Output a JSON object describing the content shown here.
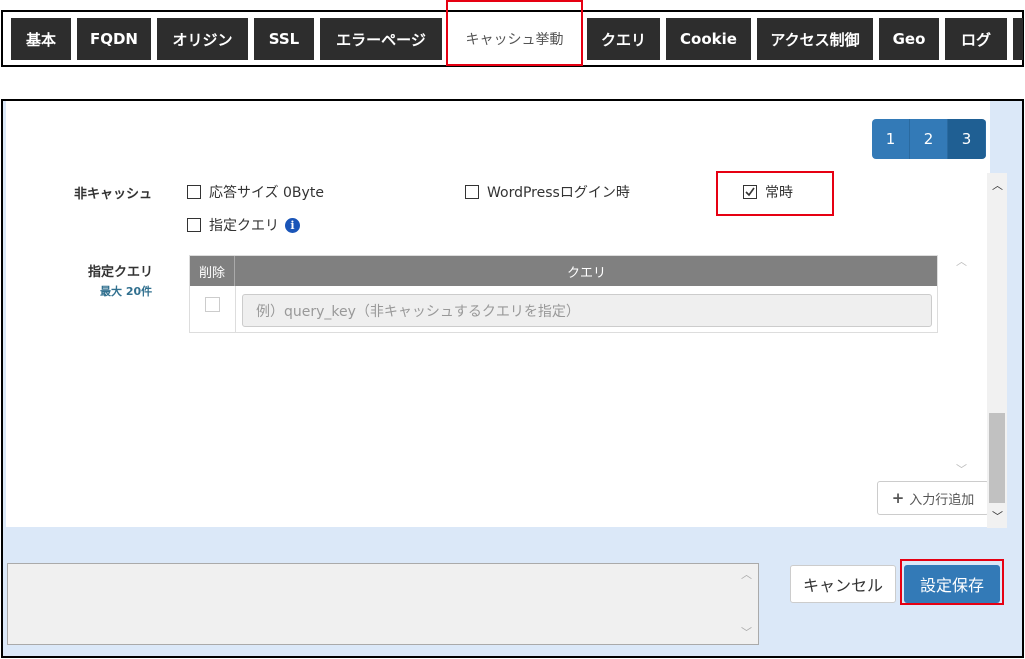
{
  "tabs": [
    {
      "label": "基本"
    },
    {
      "label": "FQDN"
    },
    {
      "label": "オリジン"
    },
    {
      "label": "SSL"
    },
    {
      "label": "エラーページ"
    },
    {
      "label": "キャッシュ挙動",
      "active": true
    },
    {
      "label": "クエリ"
    },
    {
      "label": "Cookie"
    },
    {
      "label": "アクセス制御"
    },
    {
      "label": "Geo"
    },
    {
      "label": "ログ"
    }
  ],
  "pager": [
    "1",
    "2",
    "3"
  ],
  "no_cache": {
    "label": "非キャッシュ",
    "options": [
      {
        "label": "応答サイズ 0Byte",
        "checked": false
      },
      {
        "label": "WordPressログイン時",
        "checked": false
      },
      {
        "label": "常時",
        "checked": true
      },
      {
        "label": "指定クエリ",
        "checked": false
      }
    ]
  },
  "query": {
    "label": "指定クエリ",
    "sublabel": "最大 20件",
    "col_delete": "削除",
    "col_query": "クエリ",
    "input_placeholder": "例）query_key（非キャッシュするクエリを指定）"
  },
  "add_row_label": "入力行追加",
  "buttons": {
    "cancel": "キャンセル",
    "save": "設定保存"
  },
  "colors": {
    "highlight": "#e60012",
    "primary": "#337ab7",
    "tab_bg": "#2d2d2d"
  }
}
